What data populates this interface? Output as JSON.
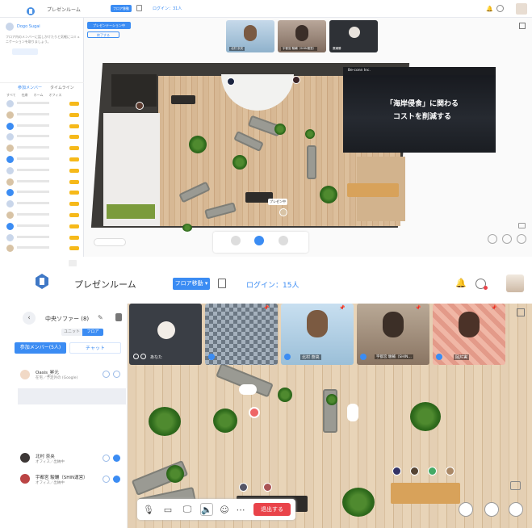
{
  "top": {
    "app_title": "プレゼンルーム",
    "floor_button": "フロア移動",
    "login_text": "ログイン：31人",
    "sidebar": {
      "user_name": "Dogo Sugai",
      "desc": "フロア内のメンバーに話しかけたりと気軽にコミュニケーションを取りましょう。",
      "tabs": [
        "参加メンバー",
        "タイムライン"
      ],
      "filters": [
        "すべて",
        "在席",
        "ホーム",
        "オフィス"
      ],
      "member_count": 14
    },
    "presentation_button": "プレゼンテーション中",
    "share_button": "終了する",
    "videos": [
      {
        "name": "北村 奈央"
      },
      {
        "name": "宇都宮 駿輔（SHIN運営）"
      },
      {
        "name": "廣瀬勝"
      }
    ],
    "slide": {
      "company": "Be-conn Inc.",
      "headline_1": "「海岸侵食」に関わる",
      "headline_2": "コストを削減する"
    },
    "sign_label": "プレゼン中"
  },
  "bottom": {
    "app_title": "プレゼンルーム",
    "floor_button": "フロア移動",
    "login_text": "ログイン：15人",
    "sidebar": {
      "area_title": "中央ソファー (8)",
      "tab_unit": "ユニット",
      "tab_floor": "フロア",
      "members_button": "参加メンバー(5人)",
      "chat_button": "チャット",
      "members": [
        {
          "name": "Oasis_昇元",
          "status": "在宅／予定外の (Google)"
        },
        {
          "name": "北村 奈央",
          "status": "オフィス／出納中"
        },
        {
          "name": "宇都宮 駿輔（SHIN運営）",
          "status": "オフィス／出納中"
        }
      ]
    },
    "videos": [
      {
        "name": "あなた"
      },
      {
        "name": ""
      },
      {
        "name": "北村 奈央"
      },
      {
        "name": "宇都宮 駿輔（SHIN…"
      },
      {
        "name": "岡芹実"
      }
    ],
    "leave_button": "退出する",
    "colors": {
      "accent": "#3b8cf3",
      "leave": "#e9434a",
      "brand_bar": "#2f8cf0"
    }
  }
}
